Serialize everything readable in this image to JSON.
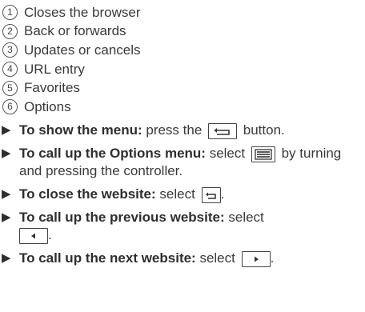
{
  "legend": [
    {
      "num": "1",
      "text": "Closes the browser"
    },
    {
      "num": "2",
      "text": "Back or forwards"
    },
    {
      "num": "3",
      "text": "Updates or cancels"
    },
    {
      "num": "4",
      "text": "URL entry"
    },
    {
      "num": "5",
      "text": "Favorites"
    },
    {
      "num": "6",
      "text": "Options"
    }
  ],
  "steps": {
    "menu": {
      "bold": "To show the menu:",
      "pre": "press the",
      "post": "button."
    },
    "options": {
      "bold": "To call up the Options menu:",
      "pre": "select",
      "post": "by turning and pressing the controller."
    },
    "close": {
      "bold": "To close the website:",
      "pre": "select",
      "post": "."
    },
    "previous": {
      "bold": "To call up the previous website:",
      "pre": "select",
      "post": "."
    },
    "next": {
      "bold": "To call up the next website:",
      "pre": "select",
      "post": "."
    }
  },
  "icons": {
    "bullet": "triangle-bullet-icon",
    "back": "back-button-icon",
    "menu": "menu-lines-icon",
    "left": "left-triangle-icon",
    "right": "right-triangle-icon"
  }
}
